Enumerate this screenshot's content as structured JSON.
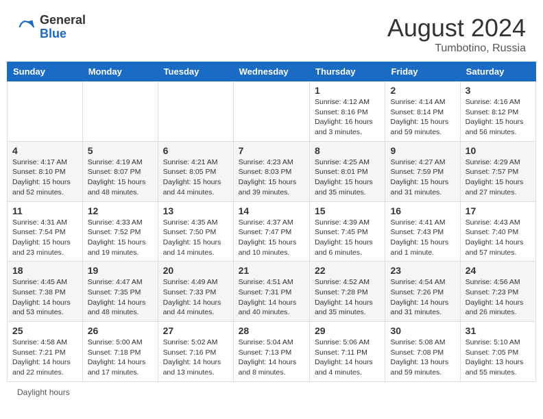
{
  "header": {
    "logo_general": "General",
    "logo_blue": "Blue",
    "month_title": "August 2024",
    "location": "Tumbotino, Russia"
  },
  "days_of_week": [
    "Sunday",
    "Monday",
    "Tuesday",
    "Wednesday",
    "Thursday",
    "Friday",
    "Saturday"
  ],
  "weeks": [
    [
      {
        "day": "",
        "info": ""
      },
      {
        "day": "",
        "info": ""
      },
      {
        "day": "",
        "info": ""
      },
      {
        "day": "",
        "info": ""
      },
      {
        "day": "1",
        "info": "Sunrise: 4:12 AM\nSunset: 8:16 PM\nDaylight: 16 hours\nand 3 minutes."
      },
      {
        "day": "2",
        "info": "Sunrise: 4:14 AM\nSunset: 8:14 PM\nDaylight: 15 hours\nand 59 minutes."
      },
      {
        "day": "3",
        "info": "Sunrise: 4:16 AM\nSunset: 8:12 PM\nDaylight: 15 hours\nand 56 minutes."
      }
    ],
    [
      {
        "day": "4",
        "info": "Sunrise: 4:17 AM\nSunset: 8:10 PM\nDaylight: 15 hours\nand 52 minutes."
      },
      {
        "day": "5",
        "info": "Sunrise: 4:19 AM\nSunset: 8:07 PM\nDaylight: 15 hours\nand 48 minutes."
      },
      {
        "day": "6",
        "info": "Sunrise: 4:21 AM\nSunset: 8:05 PM\nDaylight: 15 hours\nand 44 minutes."
      },
      {
        "day": "7",
        "info": "Sunrise: 4:23 AM\nSunset: 8:03 PM\nDaylight: 15 hours\nand 39 minutes."
      },
      {
        "day": "8",
        "info": "Sunrise: 4:25 AM\nSunset: 8:01 PM\nDaylight: 15 hours\nand 35 minutes."
      },
      {
        "day": "9",
        "info": "Sunrise: 4:27 AM\nSunset: 7:59 PM\nDaylight: 15 hours\nand 31 minutes."
      },
      {
        "day": "10",
        "info": "Sunrise: 4:29 AM\nSunset: 7:57 PM\nDaylight: 15 hours\nand 27 minutes."
      }
    ],
    [
      {
        "day": "11",
        "info": "Sunrise: 4:31 AM\nSunset: 7:54 PM\nDaylight: 15 hours\nand 23 minutes."
      },
      {
        "day": "12",
        "info": "Sunrise: 4:33 AM\nSunset: 7:52 PM\nDaylight: 15 hours\nand 19 minutes."
      },
      {
        "day": "13",
        "info": "Sunrise: 4:35 AM\nSunset: 7:50 PM\nDaylight: 15 hours\nand 14 minutes."
      },
      {
        "day": "14",
        "info": "Sunrise: 4:37 AM\nSunset: 7:47 PM\nDaylight: 15 hours\nand 10 minutes."
      },
      {
        "day": "15",
        "info": "Sunrise: 4:39 AM\nSunset: 7:45 PM\nDaylight: 15 hours\nand 6 minutes."
      },
      {
        "day": "16",
        "info": "Sunrise: 4:41 AM\nSunset: 7:43 PM\nDaylight: 15 hours\nand 1 minute."
      },
      {
        "day": "17",
        "info": "Sunrise: 4:43 AM\nSunset: 7:40 PM\nDaylight: 14 hours\nand 57 minutes."
      }
    ],
    [
      {
        "day": "18",
        "info": "Sunrise: 4:45 AM\nSunset: 7:38 PM\nDaylight: 14 hours\nand 53 minutes."
      },
      {
        "day": "19",
        "info": "Sunrise: 4:47 AM\nSunset: 7:35 PM\nDaylight: 14 hours\nand 48 minutes."
      },
      {
        "day": "20",
        "info": "Sunrise: 4:49 AM\nSunset: 7:33 PM\nDaylight: 14 hours\nand 44 minutes."
      },
      {
        "day": "21",
        "info": "Sunrise: 4:51 AM\nSunset: 7:31 PM\nDaylight: 14 hours\nand 40 minutes."
      },
      {
        "day": "22",
        "info": "Sunrise: 4:52 AM\nSunset: 7:28 PM\nDaylight: 14 hours\nand 35 minutes."
      },
      {
        "day": "23",
        "info": "Sunrise: 4:54 AM\nSunset: 7:26 PM\nDaylight: 14 hours\nand 31 minutes."
      },
      {
        "day": "24",
        "info": "Sunrise: 4:56 AM\nSunset: 7:23 PM\nDaylight: 14 hours\nand 26 minutes."
      }
    ],
    [
      {
        "day": "25",
        "info": "Sunrise: 4:58 AM\nSunset: 7:21 PM\nDaylight: 14 hours\nand 22 minutes."
      },
      {
        "day": "26",
        "info": "Sunrise: 5:00 AM\nSunset: 7:18 PM\nDaylight: 14 hours\nand 17 minutes."
      },
      {
        "day": "27",
        "info": "Sunrise: 5:02 AM\nSunset: 7:16 PM\nDaylight: 14 hours\nand 13 minutes."
      },
      {
        "day": "28",
        "info": "Sunrise: 5:04 AM\nSunset: 7:13 PM\nDaylight: 14 hours\nand 8 minutes."
      },
      {
        "day": "29",
        "info": "Sunrise: 5:06 AM\nSunset: 7:11 PM\nDaylight: 14 hours\nand 4 minutes."
      },
      {
        "day": "30",
        "info": "Sunrise: 5:08 AM\nSunset: 7:08 PM\nDaylight: 13 hours\nand 59 minutes."
      },
      {
        "day": "31",
        "info": "Sunrise: 5:10 AM\nSunset: 7:05 PM\nDaylight: 13 hours\nand 55 minutes."
      }
    ]
  ],
  "footer": {
    "note": "Daylight hours"
  }
}
